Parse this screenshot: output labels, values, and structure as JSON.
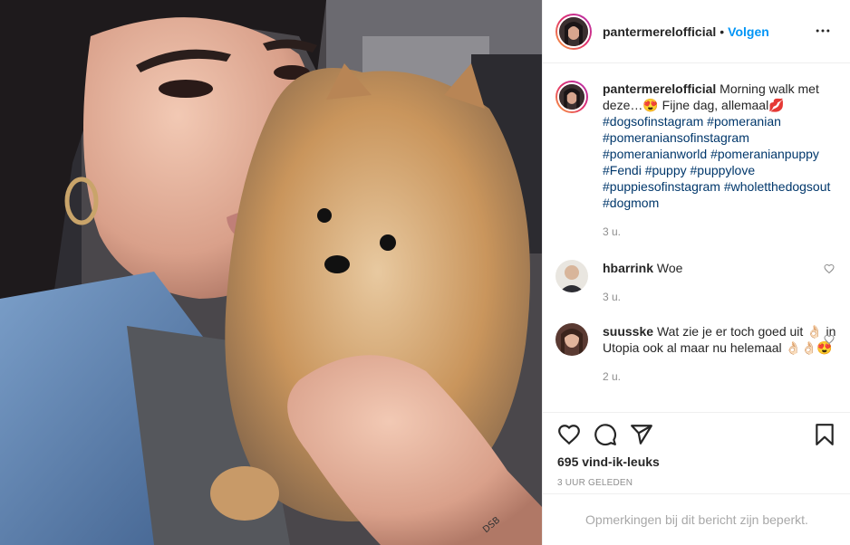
{
  "post": {
    "username": "pantermerelofficial",
    "follow_label": "Volgen",
    "dot": "•"
  },
  "caption": {
    "username": "pantermerelofficial",
    "text": "Morning walk met deze…😍 Fijne dag, allemaal💋",
    "hashtags": "#dogsofinstagram #pomeranian #pomeraniansofinstagram #pomeranianworld #pomeranianpuppy #Fendi #puppy #puppylove #puppiesofinstagram #wholetthedogsout #dogmom",
    "time": "3 u."
  },
  "comments": [
    {
      "username": "hbarrink",
      "text": "Woe",
      "time": "3 u."
    },
    {
      "username": "suusske",
      "text": "Wat zie je er toch goed uit 👌🏻 in Utopia ook al maar nu helemaal 👌🏻👌🏻😍",
      "time": "2 u."
    }
  ],
  "stats": {
    "likes": "695 vind-ik-leuks",
    "ago": "3 UUR GELEDEN"
  },
  "footer": {
    "limited": "Opmerkingen bij dit bericht zijn beperkt."
  },
  "colors": {
    "link": "#0095f6",
    "hashtag": "#00376b",
    "muted": "#8e8e8e"
  },
  "icons": [
    "more-icon",
    "heart-icon",
    "comment-icon",
    "share-icon",
    "bookmark-icon"
  ]
}
